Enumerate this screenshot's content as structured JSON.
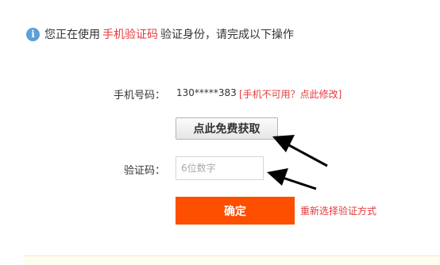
{
  "notice": {
    "prefix": "您正在使用",
    "highlight": "手机验证码",
    "suffix": "验证身份，请完成以下操作"
  },
  "phone": {
    "label": "手机号码：",
    "value": "130*****383",
    "change_link": "[手机不可用？点此修改]"
  },
  "get_code_button": "点此免费获取",
  "code": {
    "label": "验证码：",
    "placeholder": "6位数字"
  },
  "confirm_button": "确定",
  "reselect_link": "重新选择验证方式",
  "colors": {
    "accent": "#fe4e00",
    "link_red": "#e4393c",
    "info_blue": "#5a9fd8"
  }
}
